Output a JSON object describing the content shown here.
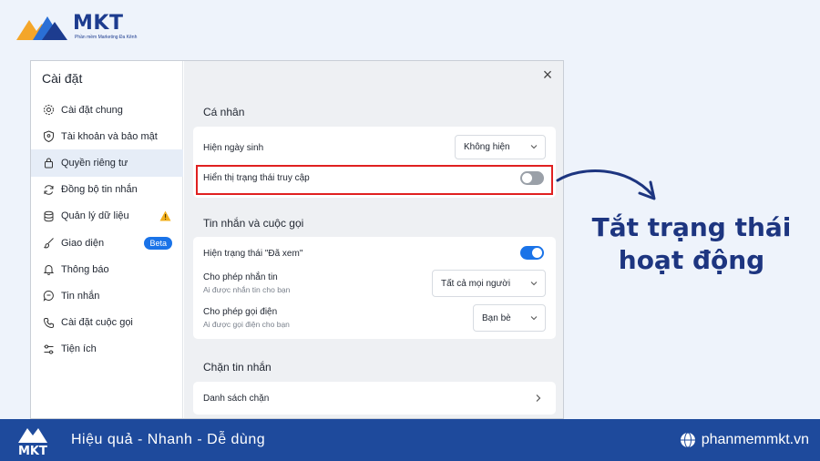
{
  "brand": {
    "name": "MKT",
    "tagline_small": "Phần mềm Marketing Đa Kênh"
  },
  "settings": {
    "title": "Cài đặt",
    "close_glyph": "×",
    "sidebar": [
      {
        "label": "Cài đặt chung",
        "icon": "gear-icon"
      },
      {
        "label": "Tài khoản và bảo mật",
        "icon": "shield-icon"
      },
      {
        "label": "Quyền riêng tư",
        "icon": "lock-icon",
        "active": true
      },
      {
        "label": "Đồng bộ tin nhắn",
        "icon": "sync-icon"
      },
      {
        "label": "Quản lý dữ liệu",
        "icon": "database-icon",
        "warning": true
      },
      {
        "label": "Giao diện",
        "icon": "brush-icon",
        "badge": "Beta"
      },
      {
        "label": "Thông báo",
        "icon": "bell-icon"
      },
      {
        "label": "Tin nhắn",
        "icon": "chat-icon"
      },
      {
        "label": "Cài đặt cuộc gọi",
        "icon": "phone-icon"
      },
      {
        "label": "Tiện ích",
        "icon": "sliders-icon"
      }
    ],
    "sections": {
      "personal": {
        "title": "Cá nhân",
        "birthday_label": "Hiện ngày sinh",
        "birthday_value": "Không hiện",
        "status_label": "Hiển thị trạng thái truy cập",
        "status_on": false
      },
      "messages_calls": {
        "title": "Tin nhắn và cuộc gọi",
        "seen_label": "Hiện trạng thái \"Đã xem\"",
        "seen_on": true,
        "allow_msg_label": "Cho phép nhắn tin",
        "allow_msg_sub": "Ai được nhắn tin cho bạn",
        "allow_msg_value": "Tất cả mọi người",
        "allow_call_label": "Cho phép gọi điện",
        "allow_call_sub": "Ai được gọi điện cho bạn",
        "allow_call_value": "Bạn bè"
      },
      "block": {
        "title": "Chặn tin nhắn",
        "list_label": "Danh sách chặn"
      }
    }
  },
  "annotation": {
    "line1": "Tắt trạng thái",
    "line2": "hoạt động",
    "color": "#1d3580"
  },
  "footer": {
    "tagline": "Hiệu quả - Nhanh  - Dễ dùng",
    "site": "phanmemmkt.vn",
    "background": "#1e4a9c"
  }
}
